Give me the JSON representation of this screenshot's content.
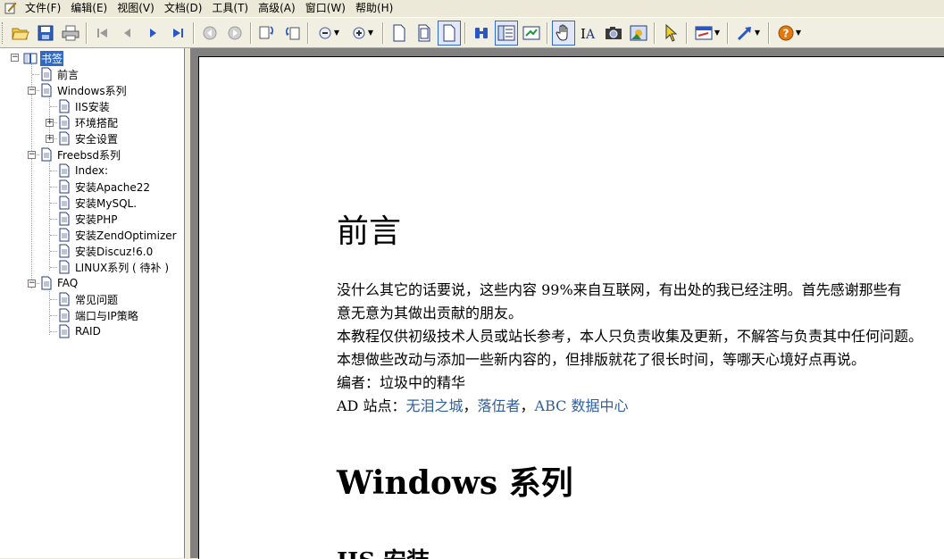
{
  "menu": [
    "文件(F)",
    "编辑(E)",
    "视图(V)",
    "文档(D)",
    "工具(T)",
    "高级(A)",
    "窗口(W)",
    "帮助(H)"
  ],
  "toolbar": {
    "buttons": [
      "open-icon",
      "save-icon",
      "print-icon",
      "first-page-icon",
      "prev-page-icon",
      "next-page-icon",
      "last-page-icon",
      "back-icon",
      "forward-icon",
      "rotate-icon",
      "rotate2-icon",
      "zoom-out-icon",
      "zoom-in-icon",
      "page-icon",
      "page2-icon",
      "page3-icon",
      "find-icon",
      "bookmark-view-icon",
      "fit-icon",
      "hand-icon",
      "text-select-icon",
      "snapshot-icon",
      "image-icon",
      "pointer-icon",
      "annotation-icon",
      "link-icon",
      "help-icon"
    ]
  },
  "tree": {
    "root": "书签",
    "items": [
      {
        "label": "前言",
        "level": 1
      },
      {
        "label": "Windows系列",
        "level": 1,
        "expanded": true
      },
      {
        "label": "IIS安装",
        "level": 2
      },
      {
        "label": "环境搭配",
        "level": 2,
        "collapsed": true
      },
      {
        "label": "安全设置",
        "level": 2,
        "collapsed": true
      },
      {
        "label": "Freebsd系列",
        "level": 1,
        "expanded": true
      },
      {
        "label": "Index:",
        "level": 2
      },
      {
        "label": "安装Apache22",
        "level": 2
      },
      {
        "label": "安装MySQL.",
        "level": 2
      },
      {
        "label": "安装PHP",
        "level": 2
      },
      {
        "label": "安装ZendOptimizer",
        "level": 2
      },
      {
        "label": "安装Discuz!6.0",
        "level": 2
      },
      {
        "label": "LINUX系列 ( 待补 )",
        "level": 2
      },
      {
        "label": "FAQ",
        "level": 1,
        "expanded": true
      },
      {
        "label": "常见问题",
        "level": 2
      },
      {
        "label": "端口与IP策略",
        "level": 2
      },
      {
        "label": "RAID",
        "level": 2
      }
    ]
  },
  "document": {
    "heading1": "前言",
    "para1_line1": "没什么其它的话要说，这些内容 99%来自互联网，有出处的我已经注明。首先感谢那些有",
    "para1_line2": "意无意为其做出贡献的朋友。",
    "para2": "本教程仅供初级技术人员或站长参考，本人只负责收集及更新，不解答与负责其中任何问题。",
    "para3": "本想做些改动与添加一些新内容的，但排版就花了很长时间，等哪天心境好点再说。",
    "para4": "编者：垃圾中的精华",
    "ad_prefix": "AD 站点：",
    "ad_link1": "无泪之城",
    "ad_sep1": "，",
    "ad_link2": "落伍者",
    "ad_sep2": "，",
    "ad_link3": "ABC 数据中心",
    "heading2": "Windows 系列",
    "heading3": "IIS 安装"
  },
  "colors": {
    "selection": "#316ac5",
    "link": "#2e5fa0",
    "frame": "#808080"
  }
}
